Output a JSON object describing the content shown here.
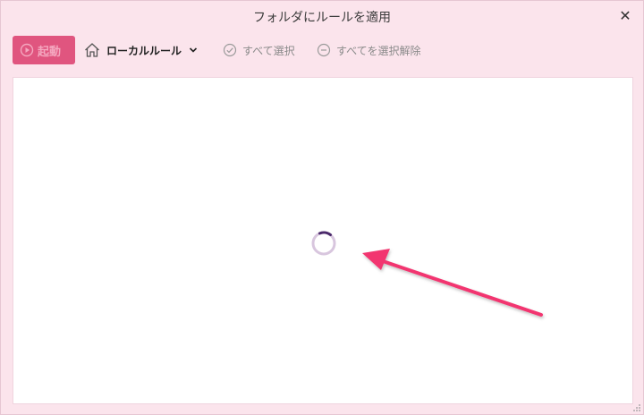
{
  "window": {
    "title": "フォルダにルールを適用",
    "close_glyph": "✕"
  },
  "toolbar": {
    "start_label": "起動",
    "rule_scope_label": "ローカルルール",
    "select_all_label": "すべて選択",
    "deselect_all_label": "すべてを選択解除"
  },
  "content": {
    "state": "loading"
  },
  "colors": {
    "window_bg": "#fbe4ec",
    "start_button_bg": "#e0557f",
    "spinner_track": "#d8c6de",
    "spinner_arc": "#4b2a6b",
    "annotation_arrow": "#f2356f"
  },
  "icons": {
    "start": "play-circle-icon",
    "home": "home-icon",
    "dropdown": "chevron-down-icon",
    "select_all": "check-circle-icon",
    "deselect_all": "minus-circle-icon",
    "close": "close-icon"
  }
}
